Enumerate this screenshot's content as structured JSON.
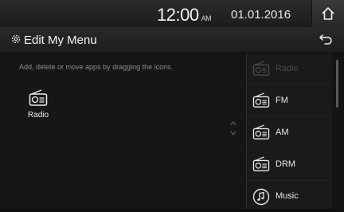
{
  "status": {
    "time": "12:00",
    "ampm": "AM",
    "date": "01.01.2016"
  },
  "header": {
    "title": "Edit My Menu"
  },
  "content": {
    "hint": "Add, delete or move apps by dragging the icons.",
    "my_menu_items": [
      {
        "label": "Radio",
        "icon": "radio-icon"
      }
    ]
  },
  "app_list": [
    {
      "label": "Radio",
      "icon": "radio-icon",
      "dimmed": true
    },
    {
      "label": "FM",
      "icon": "radio-icon",
      "dimmed": false
    },
    {
      "label": "AM",
      "icon": "radio-icon",
      "dimmed": false
    },
    {
      "label": "DRM",
      "icon": "radio-icon",
      "dimmed": false
    },
    {
      "label": "Music",
      "icon": "music-note-icon",
      "dimmed": false
    }
  ],
  "colors": {
    "background": "#131313",
    "bar": "#2a2a2c",
    "text": "#ffffff",
    "hint": "#8b8b8b"
  }
}
